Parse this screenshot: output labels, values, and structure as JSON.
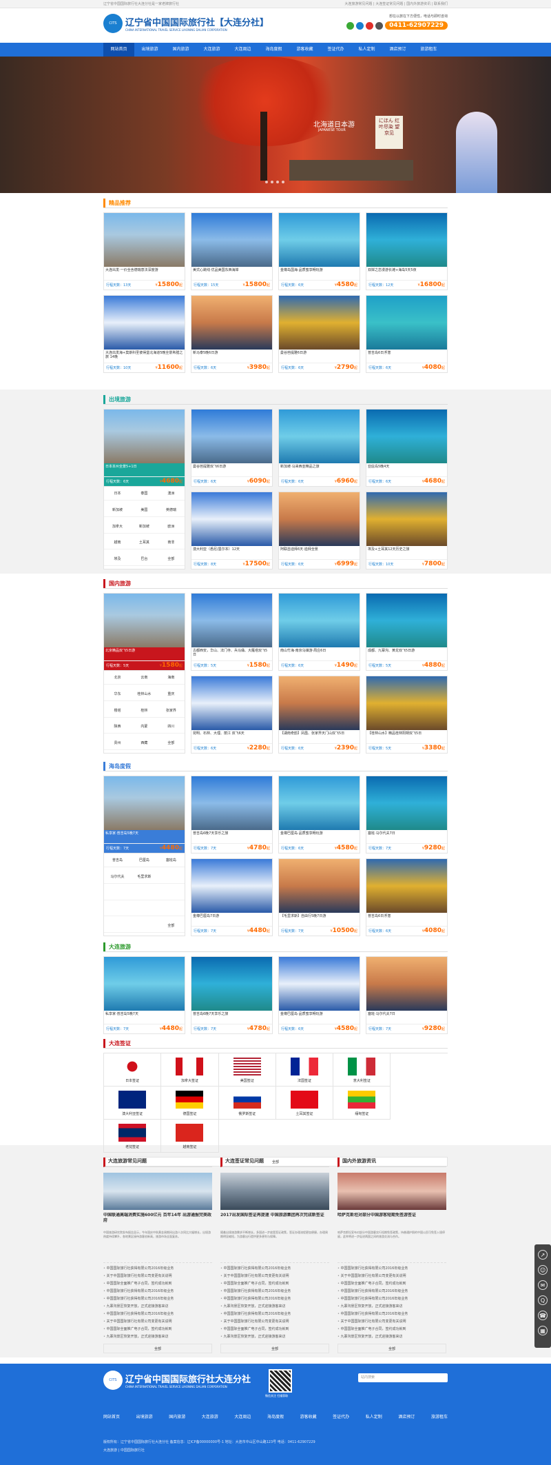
{
  "topbar": {
    "left": "辽宁省中国国际旅行社大连分社是一家老牌旅行社",
    "right": "大连旅游常见问题 | 大连签证常见问题 | 国内外旅游资讯 | 联系我们"
  },
  "header": {
    "logo_seal": "CITS",
    "logo_cn": "辽宁省中国国际旅行社【大连分社】",
    "logo_en": "CHINA INTERNATIONAL TRAVEL SERVICE LIAONING DALIAN CORPORATION",
    "slogan": "想在以旅在下方便性，电话与即时咨询",
    "phone": "0411-62907229"
  },
  "nav": [
    "网站首页",
    "出境旅游",
    "国内旅游",
    "大连旅游",
    "大连周边",
    "海岛度假",
    "游客收藏",
    "签证代办",
    "私人定制",
    "酒店预订",
    "旅游租车"
  ],
  "banner": {
    "title": "北海道日本游",
    "sub": "JAPANESE TOUR",
    "vert": "にほん 红叶尽染 望京见"
  },
  "sections": {
    "jingpin": {
      "title": "精品推荐",
      "color": "#ff8a00"
    },
    "chujing": {
      "title": "出境旅游",
      "color": "#1aa79a"
    },
    "guonei": {
      "title": "国内旅游",
      "color": "#c8161d"
    },
    "haidao": {
      "title": "海岛度假",
      "color": "#3a7dd8"
    },
    "dalian": {
      "title": "大连旅游",
      "color": "#2d9a2d"
    },
    "qianzheng": {
      "title": "大连签证",
      "color": "#c8161d"
    }
  },
  "jingpin": [
    {
      "name": "大连出发·一价全含德瑞意法深度游",
      "days": "行程天数：13天",
      "price": "15800"
    },
    {
      "name": "美式心跳线·优品美国东西海岸",
      "days": "行程天数：15天",
      "price": "15800"
    },
    {
      "name": "金樽岛国海·品质蜜享畅玩游",
      "days": "行程天数：6天",
      "price": "4580"
    },
    {
      "name": "双岸之恋漫游长滩+海岛5天5夜",
      "days": "行程天数：12天",
      "price": "16800"
    },
    {
      "name": "大连出发海+莫斯科圣彼得堡北海道5晚全景希腊之旅 14晚",
      "days": "行程天数：10天",
      "price": "11600"
    },
    {
      "name": "新马泰5晚6日游",
      "days": "行程天数：6天",
      "price": "3980"
    },
    {
      "name": "曼谷芭提雅6日游",
      "days": "行程天数：6天",
      "price": "2790"
    },
    {
      "name": "普吉岛6日浮潜",
      "days": "行程天数：6天",
      "price": "4080"
    }
  ],
  "chujing": {
    "feature": {
      "name": "日本本州全景5+1日",
      "days": "行程天数：6天",
      "price": "4680"
    },
    "tags": [
      "日本",
      "泰国",
      "澳洲",
      "新加坡",
      "美国",
      "英德瑞",
      "加拿大",
      "新加坡",
      "欧洲",
      "越南",
      "土耳其",
      "南非",
      "埃及",
      "巴台",
      "全部"
    ],
    "items": [
      {
        "name": "曼谷芭提雅双飞6日游",
        "days": "行程天数：6天",
        "price": "6090"
      },
      {
        "name": "新加坡·马来西亚精品之旅",
        "days": "行程天数：6天",
        "price": "6960"
      },
      {
        "name": "亚庇岛5晚4天",
        "days": "行程天数：6天",
        "price": "4680"
      },
      {
        "name": "澳大利亚（悉尼/墨尔本）12天",
        "days": "行程天数：8天",
        "price": "17500"
      },
      {
        "name": "阿联酋迪拜6天·迪拜全景",
        "days": "行程天数：6天",
        "price": "6999"
      },
      {
        "name": "埃及+土耳其12天历史之旅",
        "days": "行程天数：10天",
        "price": "7800"
      }
    ]
  },
  "guonei": {
    "feature": {
      "name": "北京精品双飞5日游",
      "days": "行程天数：5天",
      "price": "1580"
    },
    "tags": [
      "北京",
      "云南",
      "海南",
      "华东",
      "桂林山水",
      "重庆",
      "楼塔",
      "桂林",
      "张家界",
      "陕西",
      "内蒙",
      "四川",
      "贵州",
      "西藏",
      "全部"
    ],
    "items": [
      {
        "name": "古都西安，华山、法门寺、兵马俑、大雁塔双飞5日",
        "days": "行程天数：5天",
        "price": "1580"
      },
      {
        "name": "南山竹海·南京乌镇游·周庄6日",
        "days": "行程天数：6天",
        "price": "1490"
      },
      {
        "name": "成都、九寨沟、黄龙双飞5日游",
        "days": "行程天数：5天",
        "price": "4880"
      },
      {
        "name": "昆明、石林、大理、丽江 双飞6天",
        "days": "行程天数：6天",
        "price": "2280"
      },
      {
        "name": "【湖南奇韵】凤凰、张家界天门山双飞5日",
        "days": "行程天数：6天",
        "price": "2390"
      },
      {
        "name": "【桂林山水】精品桂林阳朔双飞5日",
        "days": "行程天数：5天",
        "price": "3380"
      }
    ]
  },
  "haidao": {
    "feature": {
      "name": "私享家·普吉岛5晚7天",
      "days": "行程天数：7天",
      "price": "4480"
    },
    "tags": [
      "普吉岛",
      "巴厘岛",
      "塞班岛",
      "马尔代夫",
      "毛里求斯",
      "",
      "",
      "",
      "",
      "",
      "",
      "",
      "",
      "",
      "全部"
    ],
    "items": [
      {
        "name": "普吉岛6晚7天享乐之旅",
        "days": "行程天数：7天",
        "price": "4780"
      },
      {
        "name": "金樽巴厘岛·品质蜜享畅玩游",
        "days": "行程天数：6天",
        "price": "4580"
      },
      {
        "name": "塞班·马尔代夫7日",
        "days": "行程天数：7天",
        "price": "9280"
      },
      {
        "name": "金樽巴厘岛7日游",
        "days": "行程天数：7天",
        "price": "4480"
      },
      {
        "name": "【毛里求斯】自由行5晚7日游",
        "days": "行程天数：7天",
        "price": "10500"
      },
      {
        "name": "普吉岛6日浮潜",
        "days": "行程天数：6天",
        "price": "4080"
      }
    ]
  },
  "dalian": [
    {
      "name": "私享家·普吉岛5晚7天",
      "days": "行程天数：7天",
      "price": "4480"
    },
    {
      "name": "普吉岛6晚7天享乐之旅",
      "days": "行程天数：7天",
      "price": "4780"
    },
    {
      "name": "金樽巴厘岛·品质蜜享畅玩游",
      "days": "行程天数：6天",
      "price": "4580"
    },
    {
      "name": "塞班·马尔代夫7日",
      "days": "行程天数：7天",
      "price": "9280"
    }
  ],
  "visas": [
    "日本签证",
    "加拿大签证",
    "美国签证",
    "法国签证",
    "意大利签证",
    "澳大利亚签证",
    "德国签证",
    "俄罗斯签证",
    "土耳其签证",
    "缅甸签证",
    "老挝签证",
    "越南签证"
  ],
  "visa_all": "全部",
  "news": [
    {
      "head": "大连旅游常见问题",
      "title": "中国联通高端消费实施600亿元 百年14年 出游通报完美政府",
      "desc": "中国旅游研究院发布报告显示，今年国庆中秋黄金周期间出游人次同比大幅增长，出境游热度持续攀升，各地景区接待游客创新高，旅游市场全面复苏。",
      "list": [
        "中国国际旅行社获得有限公司2016年级业务",
        "关于中国国际旅行社有限公司变更有关说明",
        "中国国际全面推广电子合同，签约成功就到",
        "中国国际旅行社获得有限公司2016年级业务",
        "中国国际旅行社获得有限公司2016年级业务",
        "九寨沟景区恢复开放，正式迎接游客来访",
        "中国国际旅行社获得有限公司2016年级业务",
        "关于中国国际旅行社有限公司变更有关说明",
        "中国国际全面推广电子合同，签约成功就到",
        "九寨沟景区恢复开放，正式迎接游客来访"
      ],
      "all": "全部"
    },
    {
      "head": "大连签证常见问题",
      "title": "2017出发国际签证再提速 中国旅游集团再次完成新签证",
      "desc": "随着出境旅游需求不断增长，多国进一步放宽签证政策，签证办理流程更加便捷，办理周期明显缩短，为游客出行提供更多便利与保障。",
      "list": [
        "中国国际旅行社获得有限公司2016年级业务",
        "关于中国国际旅行社有限公司变更有关说明",
        "中国国际全面推广电子合同，签约成功就到",
        "中国国际旅行社获得有限公司2016年级业务",
        "中国国际旅行社获得有限公司2016年级业务",
        "九寨沟景区恢复开放，正式迎接游客来访",
        "中国国际旅行社获得有限公司2016年级业务",
        "关于中国国际旅行社有限公司变更有关说明",
        "中国国际全面推广电子合同，签约成功就到",
        "九寨沟景区恢复开放，正式迎接游客来访"
      ],
      "all": "全部"
    },
    {
      "head": "国内外旅游资讯",
      "title": "哈萨克斯坦对部分中国游客短期免签游签证",
      "desc": "哈萨克斯坦宣布对部分中国游客实行短期免签政策，持普通护照的中国公民可免签入境停留，此举将进一步促进两国之间的旅游交流与合作。",
      "list": [
        "中国国际旅行社获得有限公司2016年级业务",
        "关于中国国际旅行社有限公司变更有关说明",
        "中国国际全面推广电子合同，签约成功就到",
        "中国国际旅行社获得有限公司2016年级业务",
        "中国国际旅行社获得有限公司2016年级业务",
        "九寨沟景区恢复开放，正式迎接游客来访",
        "中国国际旅行社获得有限公司2016年级业务",
        "关于中国国际旅行社有限公司变更有关说明",
        "中国国际全面推广电子合同，签约成功就到",
        "九寨沟景区恢复开放，正式迎接游客来访"
      ],
      "all": "全部"
    }
  ],
  "footer": {
    "logo_cn": "辽宁省中国国际旅行社大连分社",
    "logo_en": "CHINA INTERNATIONAL TRAVEL SERVICE LIAONING DALIAN CORPORATION",
    "qr_text": "微信关注 扫描获取",
    "search_placeholder": "站内搜索",
    "nav": [
      "网站首页",
      "出境旅游",
      "国内旅游",
      "大连旅游",
      "大连周边",
      "海岛度假",
      "游客收藏",
      "签证代办",
      "私人定制",
      "酒店预订",
      "旅游租车"
    ],
    "line1": "版权所有：辽宁省中国国际旅行社大连分社    备案信息：辽ICP备00000000号-1    地址：大连市中山区中山路123号    电话：0411-62907229",
    "line2": "大连旅游 | 中国国际旅行社"
  }
}
